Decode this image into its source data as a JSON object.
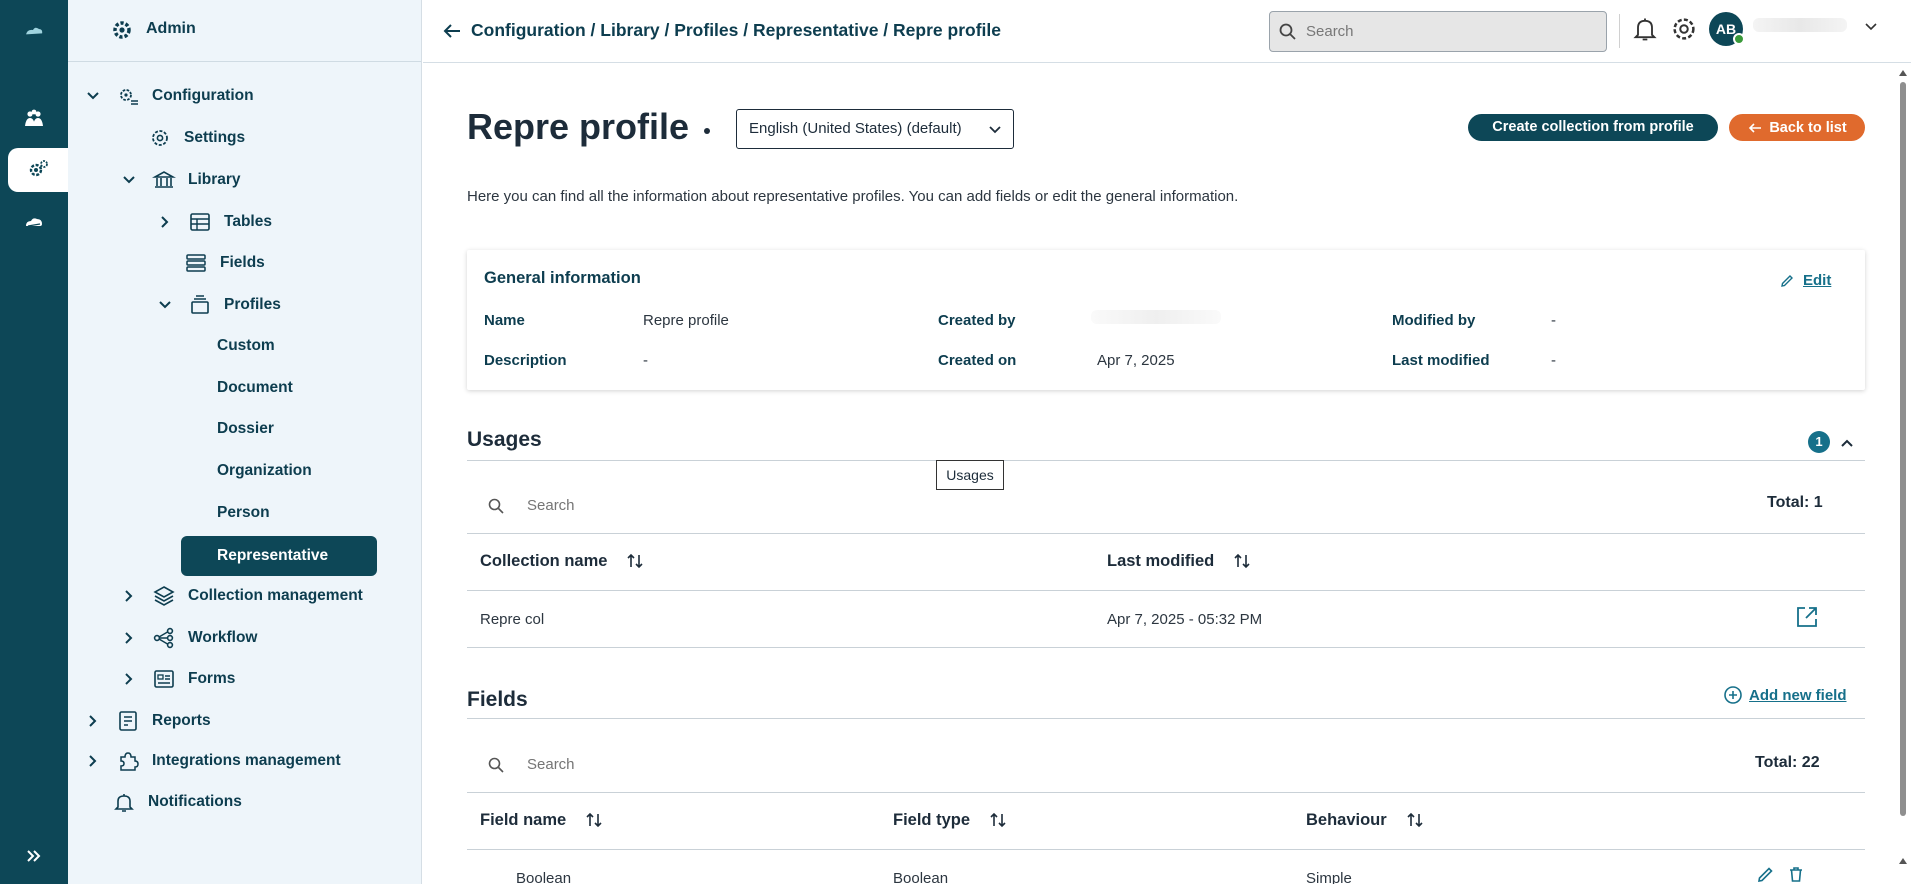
{
  "rail": {
    "items": [
      {
        "icon": "cloud-logo-icon"
      },
      {
        "icon": "people-icon"
      },
      {
        "icon": "gears-icon",
        "active": true
      },
      {
        "icon": "cloud-icon"
      },
      {
        "icon": "expand-icon"
      }
    ]
  },
  "sidebar": {
    "header_label": "Admin",
    "items": {
      "configuration": "Configuration",
      "settings": "Settings",
      "library": "Library",
      "tables": "Tables",
      "fields": "Fields",
      "profiles": "Profiles",
      "custom": "Custom",
      "document": "Document",
      "dossier": "Dossier",
      "organization": "Organization",
      "person": "Person",
      "representative": "Representative",
      "collection_management": "Collection management",
      "workflow": "Workflow",
      "forms": "Forms",
      "reports": "Reports",
      "integrations_management": "Integrations management",
      "notifications": "Notifications"
    }
  },
  "topbar": {
    "breadcrumb": "Configuration / Library / Profiles / Representative / Repre profile",
    "search_placeholder": "Search",
    "avatar_initials": "AB"
  },
  "page": {
    "title": "Repre profile",
    "language": "English (United States) (default)",
    "create_collection_label": "Create collection from profile",
    "back_label": "Back to list",
    "intro": "Here you can find all the information about representative profiles. You can add fields or edit the general information."
  },
  "general_info": {
    "title": "General information",
    "edit_label": "Edit",
    "name_label": "Name",
    "name_value": "Repre profile",
    "description_label": "Description",
    "description_value": "-",
    "created_by_label": "Created by",
    "created_on_label": "Created on",
    "created_on_value": "Apr 7, 2025",
    "modified_by_label": "Modified by",
    "modified_by_value": "-",
    "last_modified_label": "Last modified",
    "last_modified_value": "-"
  },
  "usages": {
    "title": "Usages",
    "count": "1",
    "tooltip": "Usages",
    "search_placeholder": "Search",
    "total": "Total: 1",
    "columns": [
      "Collection name",
      "Last modified"
    ],
    "rows": [
      {
        "name": "Repre col",
        "modified": "Apr 7, 2025 - 05:32 PM"
      }
    ]
  },
  "fields": {
    "title": "Fields",
    "add_label": "Add new field",
    "search_placeholder": "Search",
    "total": "Total: 22",
    "columns": [
      "Field name",
      "Field type",
      "Behaviour"
    ],
    "rows": [
      {
        "name": "Boolean",
        "type": "Boolean",
        "behaviour": "Simple"
      }
    ]
  }
}
